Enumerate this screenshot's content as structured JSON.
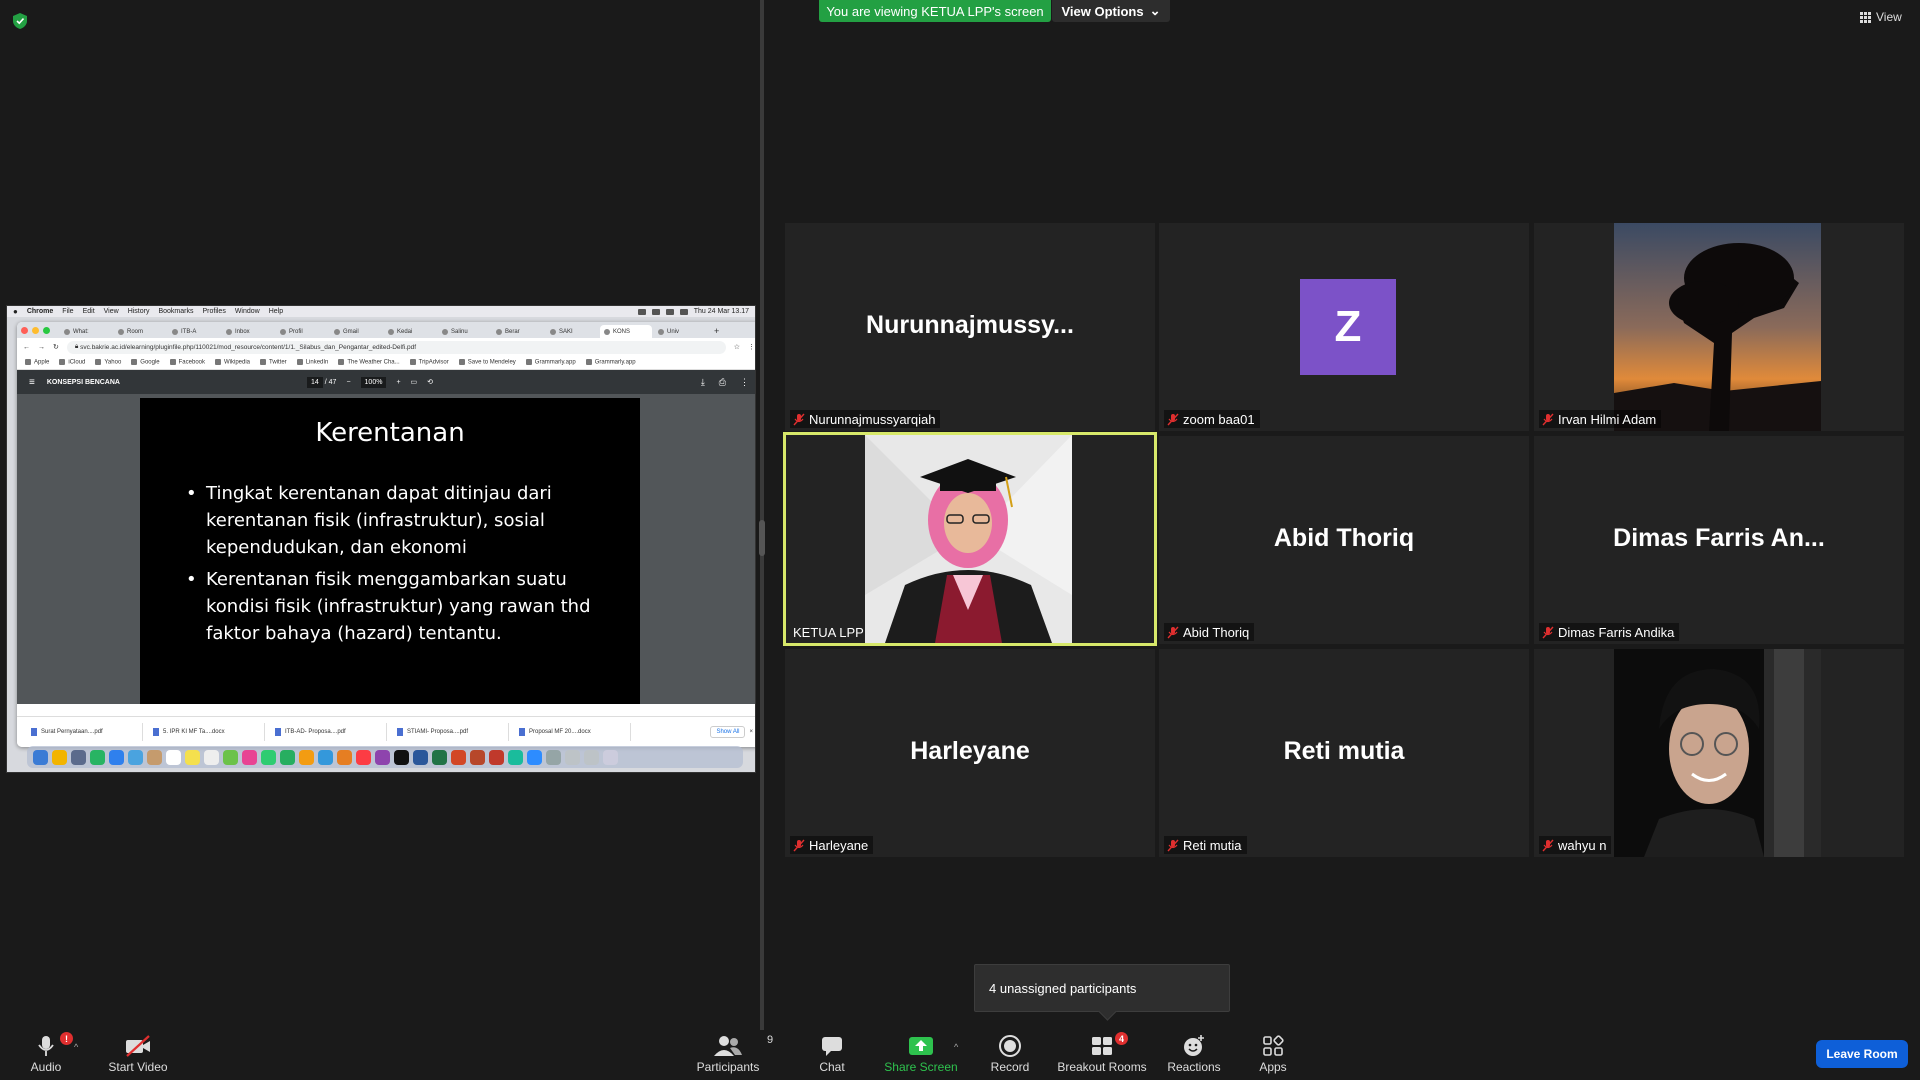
{
  "banner": {
    "viewing_text": "You are viewing KETUA LPP's screen",
    "view_options_label": "View Options",
    "view_label": "View"
  },
  "shared_screen": {
    "mac_menu": [
      "Chrome",
      "File",
      "Edit",
      "View",
      "History",
      "Bookmarks",
      "Profiles",
      "Window",
      "Help"
    ],
    "clock": "Thu 24 Mar 13.17",
    "tabs": [
      "What:",
      "Room",
      "ITB-A",
      "Inbox",
      "Profil",
      "Gmail",
      "Kedai",
      "Salinu",
      "Berar",
      "SAKI",
      "KONS",
      "Univ"
    ],
    "url": "svc.bakrie.ac.id/elearning/pluginfile.php/110021/mod_resource/content/1/1._Silabus_dan_Pengantar_edited-Delfi.pdf",
    "bookmarks": [
      "Apple",
      "iCloud",
      "Yahoo",
      "Google",
      "Facebook",
      "Wikipedia",
      "Twitter",
      "LinkedIn",
      "The Weather Cha...",
      "TripAdvisor",
      "Save to Mendeley",
      "Grammarly.app",
      "Grammarly.app"
    ],
    "pdf_title": "KONSEPSI BENCANA",
    "pdf_page": "14",
    "pdf_page_total": "/ 47",
    "pdf_zoom": "100%",
    "slide": {
      "title": "Kerentanan",
      "bullets": [
        "Tingkat kerentanan dapat ditinjau dari kerentanan fisik (infrastruktur), sosial kependudukan, dan ekonomi",
        "Kerentanan fisik menggambarkan suatu kondisi fisik (infrastruktur) yang rawan thd faktor bahaya (hazard) tentantu."
      ]
    },
    "downloads": [
      "Surat Pernyataan....pdf",
      "5. IPR KI MF Ta....docx",
      "ITB-AD- Proposa....pdf",
      "STIAMI- Proposa....pdf",
      "Proposal MF 20....docx"
    ],
    "downloads_show_all": "Show All"
  },
  "gallery": [
    {
      "name": "Nurunnajmussyarqiah",
      "display": "Nurunnajmussy...",
      "muted": true,
      "kind": "name"
    },
    {
      "name": "zoom baa01",
      "display": "Z",
      "muted": true,
      "kind": "avatar"
    },
    {
      "name": "Irvan Hilmi Adam",
      "display": "",
      "muted": true,
      "kind": "photo-tree"
    },
    {
      "name": "KETUA LPP",
      "display": "",
      "muted": false,
      "kind": "photo-grad"
    },
    {
      "name": "Abid Thoriq",
      "display": "Abid Thoriq",
      "muted": true,
      "kind": "name"
    },
    {
      "name": "Dimas Farris Andika",
      "display": "Dimas Farris An...",
      "muted": true,
      "kind": "name"
    },
    {
      "name": "Harleyane",
      "display": "Harleyane",
      "muted": true,
      "kind": "name"
    },
    {
      "name": "Reti mutia",
      "display": "Reti mutia",
      "muted": true,
      "kind": "name"
    },
    {
      "name": "wahyu n",
      "display": "",
      "muted": true,
      "kind": "photo-person"
    }
  ],
  "popup": {
    "unassigned_text": "4 unassigned participants"
  },
  "toolbar": {
    "audio_label": "Audio",
    "audio_badge": "!",
    "video_label": "Start Video",
    "participants_label": "Participants",
    "participants_count": "9",
    "chat_label": "Chat",
    "share_label": "Share Screen",
    "record_label": "Record",
    "breakout_label": "Breakout Rooms",
    "breakout_badge": "4",
    "reactions_label": "Reactions",
    "apps_label": "Apps",
    "leave_label": "Leave Room"
  },
  "colors": {
    "banner_green": "#23a043",
    "active_speaker": "#d7e86a",
    "share_green": "#2ec24e",
    "leave_blue": "#0e5fd8",
    "avatar_purple": "#7c52c8",
    "mute_red": "#e02f2f"
  }
}
